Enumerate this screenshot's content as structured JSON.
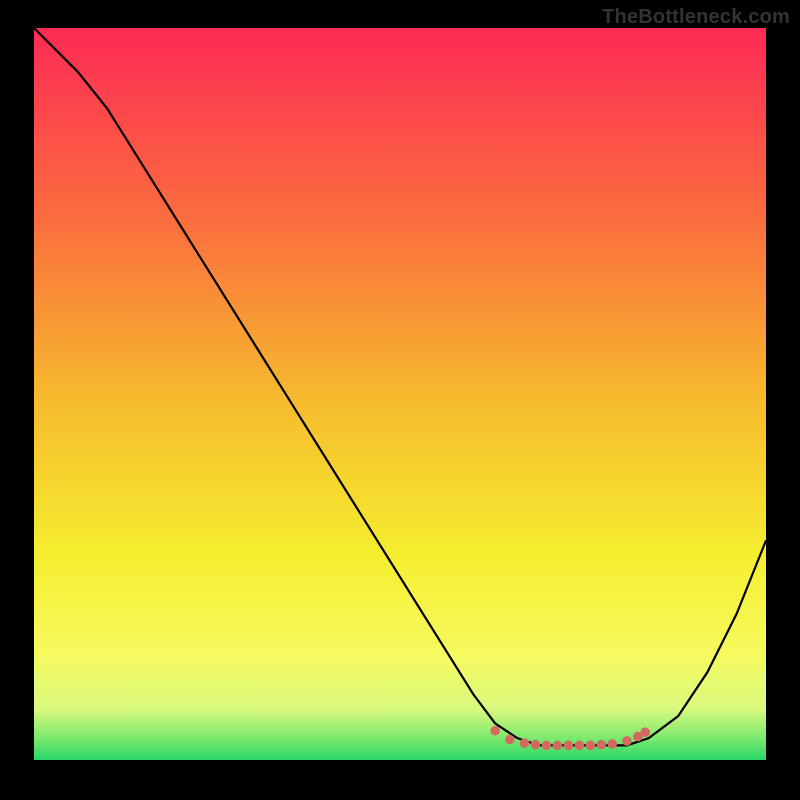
{
  "watermark": "TheBottleneck.com",
  "chart_data": {
    "type": "line",
    "title": "",
    "xlabel": "",
    "ylabel": "",
    "xlim": [
      0,
      100
    ],
    "ylim": [
      0,
      100
    ],
    "grid": false,
    "series": [
      {
        "name": "curve",
        "x": [
          0,
          3,
          6,
          10,
          15,
          20,
          25,
          30,
          35,
          40,
          45,
          50,
          55,
          60,
          63,
          66,
          69,
          72,
          75,
          78,
          81,
          84,
          88,
          92,
          96,
          100
        ],
        "values": [
          100,
          97,
          94,
          89,
          81,
          73,
          65,
          57,
          49,
          41,
          33,
          25,
          17,
          9,
          5,
          3,
          2,
          2,
          2,
          2,
          2,
          3,
          6,
          12,
          20,
          30
        ]
      }
    ],
    "markers": {
      "name": "flat-region-markers",
      "color": "#d46a5f",
      "points": [
        {
          "x": 63,
          "y": 4.0
        },
        {
          "x": 65,
          "y": 2.8
        },
        {
          "x": 67,
          "y": 2.3
        },
        {
          "x": 68.5,
          "y": 2.1
        },
        {
          "x": 70,
          "y": 2.0
        },
        {
          "x": 71.5,
          "y": 2.0
        },
        {
          "x": 73,
          "y": 2.0
        },
        {
          "x": 74.5,
          "y": 2.0
        },
        {
          "x": 76,
          "y": 2.0
        },
        {
          "x": 77.5,
          "y": 2.1
        },
        {
          "x": 79,
          "y": 2.2
        },
        {
          "x": 81,
          "y": 2.6
        },
        {
          "x": 82.5,
          "y": 3.2
        },
        {
          "x": 83.5,
          "y": 3.8
        }
      ]
    },
    "gradient_stops": [
      {
        "offset": 0,
        "color": "#fd2a55"
      },
      {
        "offset": 25,
        "color": "#fb6a3f"
      },
      {
        "offset": 50,
        "color": "#f6b82e"
      },
      {
        "offset": 72,
        "color": "#f5ee2f"
      },
      {
        "offset": 86,
        "color": "#f6fa61"
      },
      {
        "offset": 93,
        "color": "#d9f97e"
      },
      {
        "offset": 97,
        "color": "#7de96e"
      },
      {
        "offset": 100,
        "color": "#29d66a"
      }
    ]
  }
}
